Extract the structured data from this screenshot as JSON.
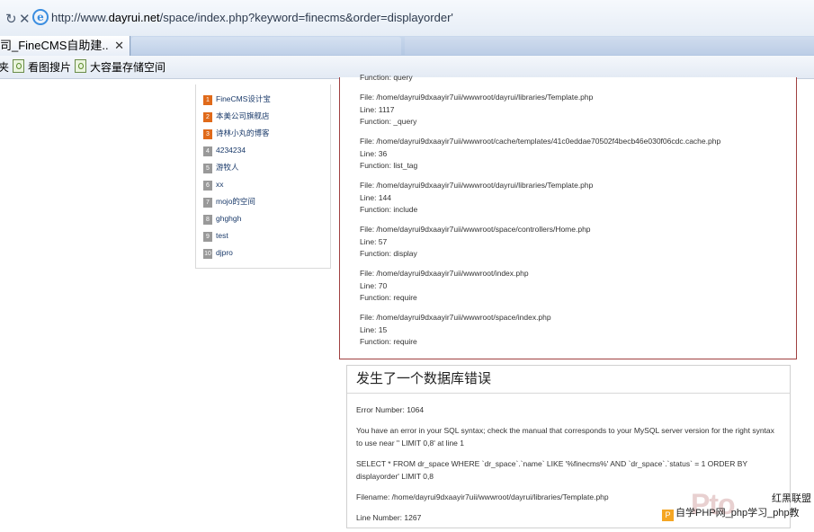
{
  "browser": {
    "url_prefix": "http://www.",
    "url_domain": "dayrui.net",
    "url_rest": "/space/index.php?keyword=finecms&order=displayorder'",
    "tab_title": "司_FineCMS自助建...",
    "tab_close": "✕",
    "favorites": [
      "看图搜片",
      "大容量存储空间"
    ],
    "fav_left_fragment": "夹"
  },
  "sidebar": {
    "items": [
      {
        "num": "1",
        "label": "FineCMS设计宝"
      },
      {
        "num": "2",
        "label": "本美公司旗舰店"
      },
      {
        "num": "3",
        "label": "诗林小丸的博客"
      },
      {
        "num": "4",
        "label": "4234234"
      },
      {
        "num": "5",
        "label": "游牧人"
      },
      {
        "num": "6",
        "label": "xx"
      },
      {
        "num": "7",
        "label": "mojo的空间"
      },
      {
        "num": "8",
        "label": "ghghgh"
      },
      {
        "num": "9",
        "label": "test"
      },
      {
        "num": "10",
        "label": "djpro"
      }
    ]
  },
  "trace": {
    "first_line": "Function: query",
    "blocks": [
      {
        "file": "File: /home/dayrui9dxaayir7uii/wwwroot/dayrui/libraries/Template.php",
        "line": "Line: 1117",
        "function": "Function: _query"
      },
      {
        "file": "File: /home/dayrui9dxaayir7uii/wwwroot/cache/templates/41c0eddae70502f4becb46e030f06cdc.cache.php",
        "line": "Line: 36",
        "function": "Function: list_tag"
      },
      {
        "file": "File: /home/dayrui9dxaayir7uii/wwwroot/dayrui/libraries/Template.php",
        "line": "Line: 144",
        "function": "Function: include"
      },
      {
        "file": "File: /home/dayrui9dxaayir7uii/wwwroot/space/controllers/Home.php",
        "line": "Line: 57",
        "function": "Function: display"
      },
      {
        "file": "File: /home/dayrui9dxaayir7uii/wwwroot/index.php",
        "line": "Line: 70",
        "function": "Function: require"
      },
      {
        "file": "File: /home/dayrui9dxaayir7uii/wwwroot/space/index.php",
        "line": "Line: 15",
        "function": "Function: require"
      }
    ]
  },
  "db_error": {
    "title": "发生了一个数据库错误",
    "error_number": "Error Number: 1064",
    "message": "You have an error in your SQL syntax; check the manual that corresponds to your MySQL server version for the right syntax to use near '' LIMIT 0,8' at line 1",
    "sql": "SELECT * FROM dr_space WHERE `dr_space`.`name` LIKE '%finecms%' AND `dr_space`.`status` = 1 ORDER BY displayorder' LIMIT 0,8",
    "filename": "Filename: /home/dayrui9dxaayir7uii/wwwroot/dayrui/libraries/Template.php",
    "line_number": "Line Number: 1267"
  },
  "watermark": {
    "logo": "Pto",
    "top_text": "红黑联盟",
    "bottom_icon": "P",
    "bottom_text": "自学PHP网_php学习_php教"
  }
}
